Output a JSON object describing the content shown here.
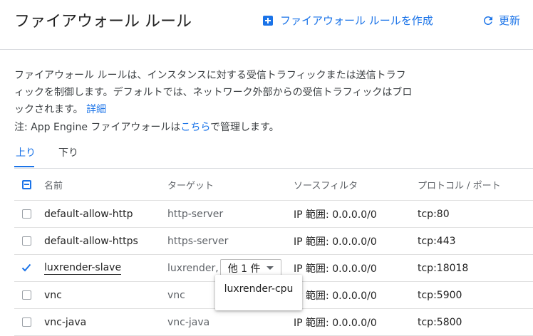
{
  "header": {
    "title": "ファイアウォール ルール",
    "create_label": "ファイアウォール ルールを作成",
    "refresh_label": "更新"
  },
  "description": {
    "text": "ファイアウォール ルールは、インスタンスに対する受信トラフィックまたは送信トラフィックを制御します。デフォルトでは、ネットワーク外部からの受信トラフィックはブロックされます。",
    "detail_link": "詳細"
  },
  "note": {
    "prefix": "注: App Engine ファイアウォールは",
    "link": "こちら",
    "suffix": "で管理します。"
  },
  "tabs": [
    {
      "label": "上り",
      "active": true
    },
    {
      "label": "下り",
      "active": false
    }
  ],
  "table": {
    "columns": {
      "name": "名前",
      "target": "ターゲット",
      "source": "ソースフィルタ",
      "protocol": "プロトコル / ポート"
    },
    "rows": [
      {
        "name": "default-allow-http",
        "target": "http-server",
        "source": "IP 範囲: 0.0.0.0/0",
        "protocol": "tcp:80",
        "checked": false
      },
      {
        "name": "default-allow-https",
        "target": "https-server",
        "source": "IP 範囲: 0.0.0.0/0",
        "protocol": "tcp:443",
        "checked": false
      },
      {
        "name": "luxrender-slave",
        "target": "luxrender,",
        "target_more": "他 1 件",
        "source": "IP 範囲: 0.0.0.0/0",
        "protocol": "tcp:18018",
        "checked": true
      },
      {
        "name": "vnc",
        "target": "vnc",
        "source": "IP 範囲: 0.0.0.0/0",
        "protocol": "tcp:5900",
        "checked": false
      },
      {
        "name": "vnc-java",
        "target": "vnc-java",
        "source": "IP 範囲: 0.0.0.0/0",
        "protocol": "tcp:5800",
        "checked": false
      }
    ]
  },
  "dropdown_menu": {
    "items": [
      "luxrender-cpu"
    ]
  },
  "colors": {
    "accent": "#1a73e8",
    "checkbox_checked": "#1a73e8"
  }
}
